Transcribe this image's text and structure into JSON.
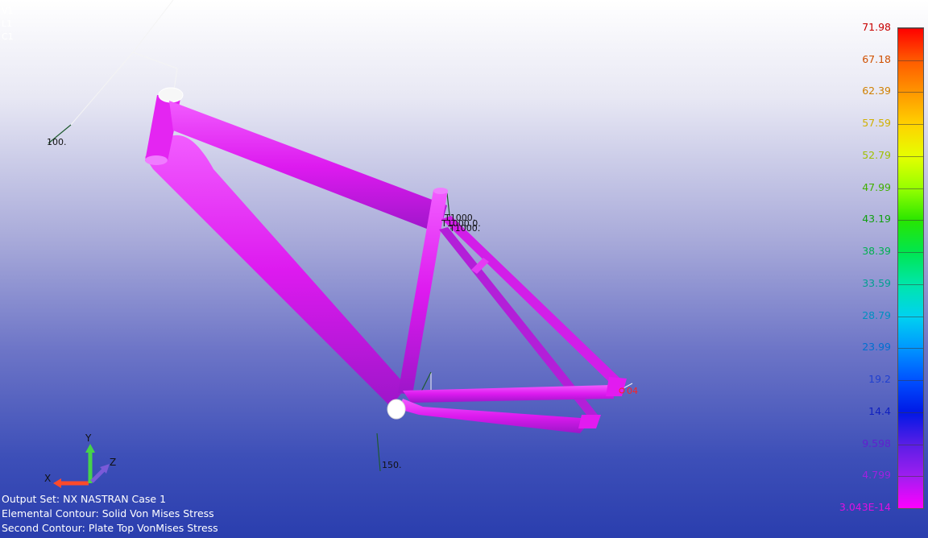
{
  "view_ids": [
    "V1",
    "L1",
    "C1"
  ],
  "info": {
    "output_set": "Output Set: NX NASTRAN Case 1",
    "elemental_contour": "Elemental Contour: Solid Von Mises Stress",
    "second_contour": "Second Contour: Plate Top VonMises Stress"
  },
  "legend": {
    "labels": [
      "71.98",
      "67.18",
      "62.39",
      "57.59",
      "52.79",
      "47.99",
      "43.19",
      "38.39",
      "33.59",
      "28.79",
      "23.99",
      "19.2",
      "14.4",
      "9.598",
      "4.799",
      "3.043E-14"
    ],
    "label_colors": [
      "#c80000",
      "#d05000",
      "#d08000",
      "#d0b000",
      "#a0c000",
      "#40b000",
      "#10a010",
      "#00b050",
      "#00a090",
      "#0090c0",
      "#0070d0",
      "#2040d0",
      "#1020c0",
      "#6020d0",
      "#a020e0",
      "#e010e0"
    ],
    "cell_colors": [
      "#ff0000",
      "#ff5a00",
      "#ff9600",
      "#ffd200",
      "#e6ff00",
      "#96ff00",
      "#28e600",
      "#00e650",
      "#00e6aa",
      "#00d2f0",
      "#0096ff",
      "#0050ff",
      "#0018e6",
      "#5a1ee6",
      "#a01ef0",
      "#ff00ff"
    ]
  },
  "model_labels": {
    "load_top": "100.",
    "load_mid_1": "T1000.",
    "load_mid_2": "T1000.0.",
    "load_mid_3": "T1000.",
    "load_bottom": "150.",
    "dropout_value": "04"
  },
  "triad": {
    "x_label": "X",
    "y_label": "Y",
    "z_label": "Z"
  },
  "colors": {
    "frame_magenta": "#e21bf0",
    "frame_dark": "#a01ad8",
    "frame_blue": "#6d38e0"
  }
}
